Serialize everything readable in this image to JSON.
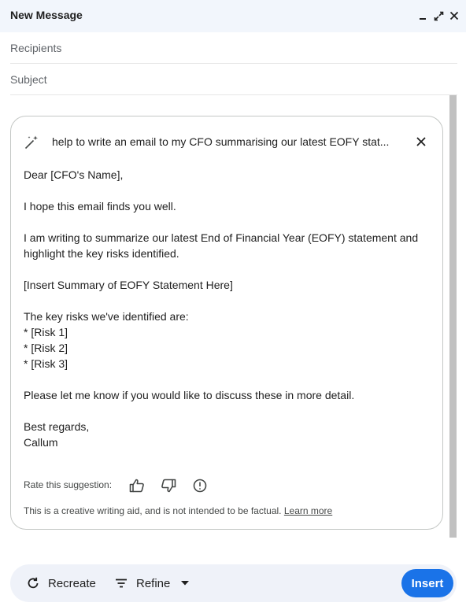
{
  "header": {
    "title": "New Message"
  },
  "fields": {
    "recipients_placeholder": "Recipients",
    "subject_placeholder": "Subject"
  },
  "assistant": {
    "prompt": "help to write an email to my CFO summarising our latest EOFY stat...",
    "body_lines": [
      "Dear [CFO's Name],",
      "",
      "I hope this email finds you well.",
      "",
      "I am writing to summarize our latest End of Financial Year (EOFY) statement and",
      "highlight the key risks identified.",
      "",
      "[Insert Summary of EOFY Statement Here]",
      "",
      "The key risks we've identified are:",
      "* [Risk 1]",
      "* [Risk 2]",
      "* [Risk 3]",
      "",
      "Please let me know if you would like to discuss these in more detail.",
      "",
      "Best regards,",
      "Callum"
    ],
    "rate_label": "Rate this suggestion:",
    "disclaimer": "This is a creative writing aid, and is not intended to be factual.",
    "learn_more": "Learn more"
  },
  "actions": {
    "recreate": "Recreate",
    "refine": "Refine",
    "insert": "Insert"
  },
  "colors": {
    "accent": "#1a73e8",
    "header_bg": "#f2f6fc",
    "bar_bg": "#eff2f9"
  }
}
